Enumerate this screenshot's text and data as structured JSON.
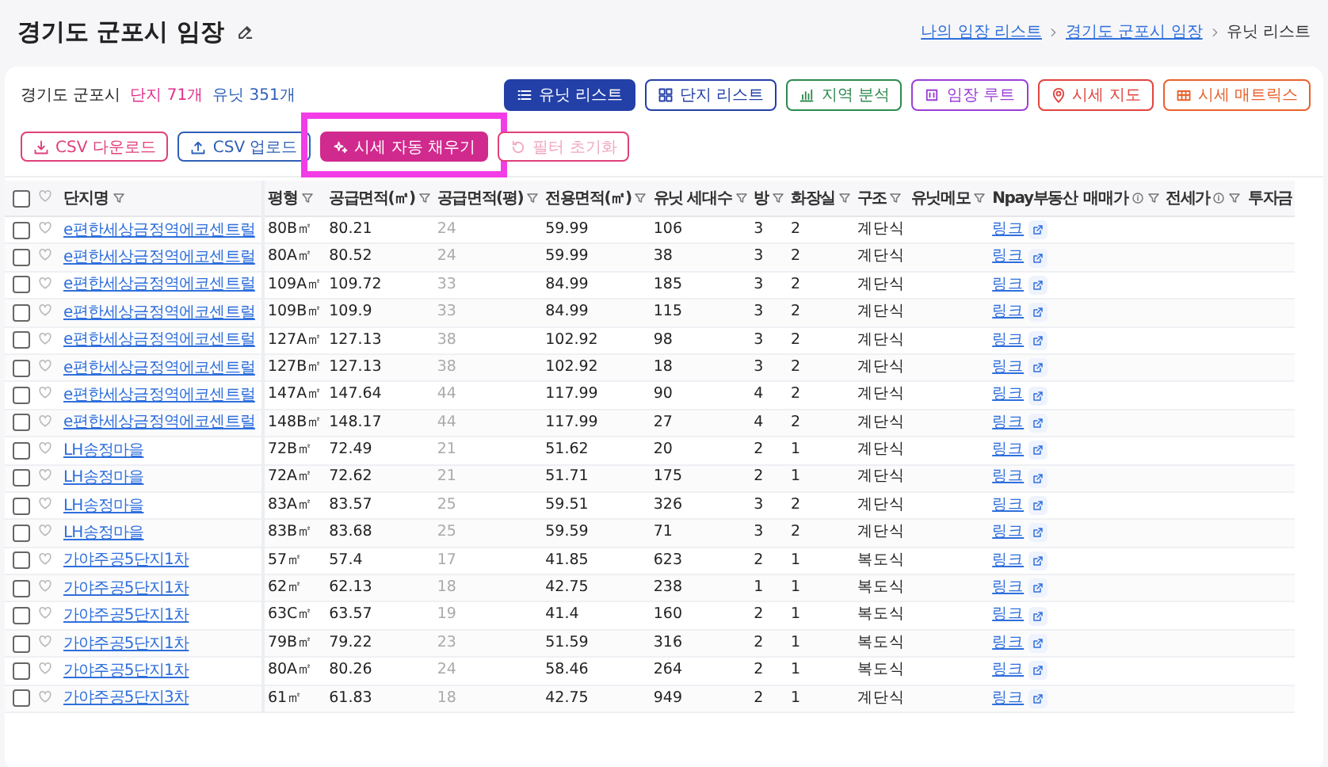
{
  "page": {
    "title": "경기도 군포시 임장"
  },
  "breadcrumb": [
    "나의 임장 리스트",
    "경기도 군포시 임장",
    "유닛 리스트"
  ],
  "summary": {
    "region": "경기도 군포시",
    "complexes": "단지 71개",
    "units": "유닛 351개"
  },
  "view_buttons": [
    {
      "label": "유닛 리스트",
      "color": "#2340a8",
      "selected": true
    },
    {
      "label": "단지 리스트",
      "color": "#2340a8",
      "selected": false
    },
    {
      "label": "지역 분석",
      "color": "#2e8a4e",
      "selected": false
    },
    {
      "label": "임장 루트",
      "color": "#9b3fd6",
      "selected": false
    },
    {
      "label": "시세 지도",
      "color": "#e0443f",
      "selected": false
    },
    {
      "label": "시세 매트릭스",
      "color": "#e8622c",
      "selected": false
    }
  ],
  "actions": [
    {
      "label": "CSV 다운로드",
      "kind": "outline",
      "color": "#e03f7a",
      "disabled": false,
      "highlighted": false
    },
    {
      "label": "CSV 업로드",
      "kind": "outline",
      "color": "#2f5fb8",
      "disabled": false,
      "highlighted": false
    },
    {
      "label": "시세 자동 채우기",
      "kind": "filled",
      "color": "#d12a8e",
      "disabled": false,
      "highlighted": true
    },
    {
      "label": "필터 초기화",
      "kind": "outline",
      "color": "#e03f7a",
      "disabled": true,
      "highlighted": false
    }
  ],
  "table": {
    "select_all": {
      "checked": false
    },
    "columns": [
      {
        "label": "단지명",
        "filter": true
      },
      {
        "label": "평형",
        "filter": true
      },
      {
        "label": "공급면적(㎡)",
        "filter": true
      },
      {
        "label": "공급면적(평)",
        "filter": true
      },
      {
        "label": "전용면적(㎡)",
        "filter": true
      },
      {
        "label": "유닛 세대수",
        "filter": true
      },
      {
        "label": "방",
        "filter": true
      },
      {
        "label": "화장실",
        "filter": true
      },
      {
        "label": "구조",
        "filter": true
      },
      {
        "label": "유닛메모",
        "filter": true
      },
      {
        "label": "Npay부동산"
      },
      {
        "label": "매매가",
        "filter": true,
        "info": true
      },
      {
        "label": "전세가",
        "filter": true,
        "info": true
      },
      {
        "label": "투자금"
      }
    ],
    "rows": [
      {
        "checked": false,
        "liked": false,
        "cells": [
          "e편한세상금정역에코센트럴",
          "80B㎡",
          "80.21",
          "24",
          "59.99",
          "106",
          "3",
          "2",
          "계단식",
          "",
          "링크"
        ]
      },
      {
        "checked": false,
        "liked": false,
        "cells": [
          "e편한세상금정역에코센트럴",
          "80A㎡",
          "80.52",
          "24",
          "59.99",
          "38",
          "3",
          "2",
          "계단식",
          "",
          "링크"
        ]
      },
      {
        "checked": false,
        "liked": false,
        "cells": [
          "e편한세상금정역에코센트럴",
          "109A㎡",
          "109.72",
          "33",
          "84.99",
          "185",
          "3",
          "2",
          "계단식",
          "",
          "링크"
        ]
      },
      {
        "checked": false,
        "liked": false,
        "cells": [
          "e편한세상금정역에코센트럴",
          "109B㎡",
          "109.9",
          "33",
          "84.99",
          "115",
          "3",
          "2",
          "계단식",
          "",
          "링크"
        ]
      },
      {
        "checked": false,
        "liked": false,
        "cells": [
          "e편한세상금정역에코센트럴",
          "127A㎡",
          "127.13",
          "38",
          "102.92",
          "98",
          "3",
          "2",
          "계단식",
          "",
          "링크"
        ]
      },
      {
        "checked": false,
        "liked": false,
        "cells": [
          "e편한세상금정역에코센트럴",
          "127B㎡",
          "127.13",
          "38",
          "102.92",
          "18",
          "3",
          "2",
          "계단식",
          "",
          "링크"
        ]
      },
      {
        "checked": false,
        "liked": false,
        "cells": [
          "e편한세상금정역에코센트럴",
          "147A㎡",
          "147.64",
          "44",
          "117.99",
          "90",
          "4",
          "2",
          "계단식",
          "",
          "링크"
        ]
      },
      {
        "checked": false,
        "liked": false,
        "cells": [
          "e편한세상금정역에코센트럴",
          "148B㎡",
          "148.17",
          "44",
          "117.99",
          "27",
          "4",
          "2",
          "계단식",
          "",
          "링크"
        ]
      },
      {
        "checked": false,
        "liked": false,
        "cells": [
          "LH송정마을",
          "72B㎡",
          "72.49",
          "21",
          "51.62",
          "20",
          "2",
          "1",
          "계단식",
          "",
          "링크"
        ]
      },
      {
        "checked": false,
        "liked": false,
        "cells": [
          "LH송정마을",
          "72A㎡",
          "72.62",
          "21",
          "51.71",
          "175",
          "2",
          "1",
          "계단식",
          "",
          "링크"
        ]
      },
      {
        "checked": false,
        "liked": false,
        "cells": [
          "LH송정마을",
          "83A㎡",
          "83.57",
          "25",
          "59.51",
          "326",
          "3",
          "2",
          "계단식",
          "",
          "링크"
        ]
      },
      {
        "checked": false,
        "liked": false,
        "cells": [
          "LH송정마을",
          "83B㎡",
          "83.68",
          "25",
          "59.59",
          "71",
          "3",
          "2",
          "계단식",
          "",
          "링크"
        ]
      },
      {
        "checked": false,
        "liked": false,
        "cells": [
          "가야주공5단지1차",
          "57㎡",
          "57.4",
          "17",
          "41.85",
          "623",
          "2",
          "1",
          "복도식",
          "",
          "링크"
        ]
      },
      {
        "checked": false,
        "liked": false,
        "cells": [
          "가야주공5단지1차",
          "62㎡",
          "62.13",
          "18",
          "42.75",
          "238",
          "1",
          "1",
          "복도식",
          "",
          "링크"
        ]
      },
      {
        "checked": false,
        "liked": false,
        "cells": [
          "가야주공5단지1차",
          "63C㎡",
          "63.57",
          "19",
          "41.4",
          "160",
          "2",
          "1",
          "복도식",
          "",
          "링크"
        ]
      },
      {
        "checked": false,
        "liked": false,
        "cells": [
          "가야주공5단지1차",
          "79B㎡",
          "79.22",
          "23",
          "51.59",
          "316",
          "2",
          "1",
          "복도식",
          "",
          "링크"
        ]
      },
      {
        "checked": false,
        "liked": false,
        "cells": [
          "가야주공5단지1차",
          "80A㎡",
          "80.26",
          "24",
          "58.46",
          "264",
          "2",
          "1",
          "복도식",
          "",
          "링크"
        ]
      },
      {
        "checked": false,
        "liked": false,
        "cells": [
          "가야주공5단지3차",
          "61㎡",
          "61.83",
          "18",
          "42.75",
          "949",
          "2",
          "1",
          "계단식",
          "",
          "링크"
        ]
      }
    ]
  }
}
